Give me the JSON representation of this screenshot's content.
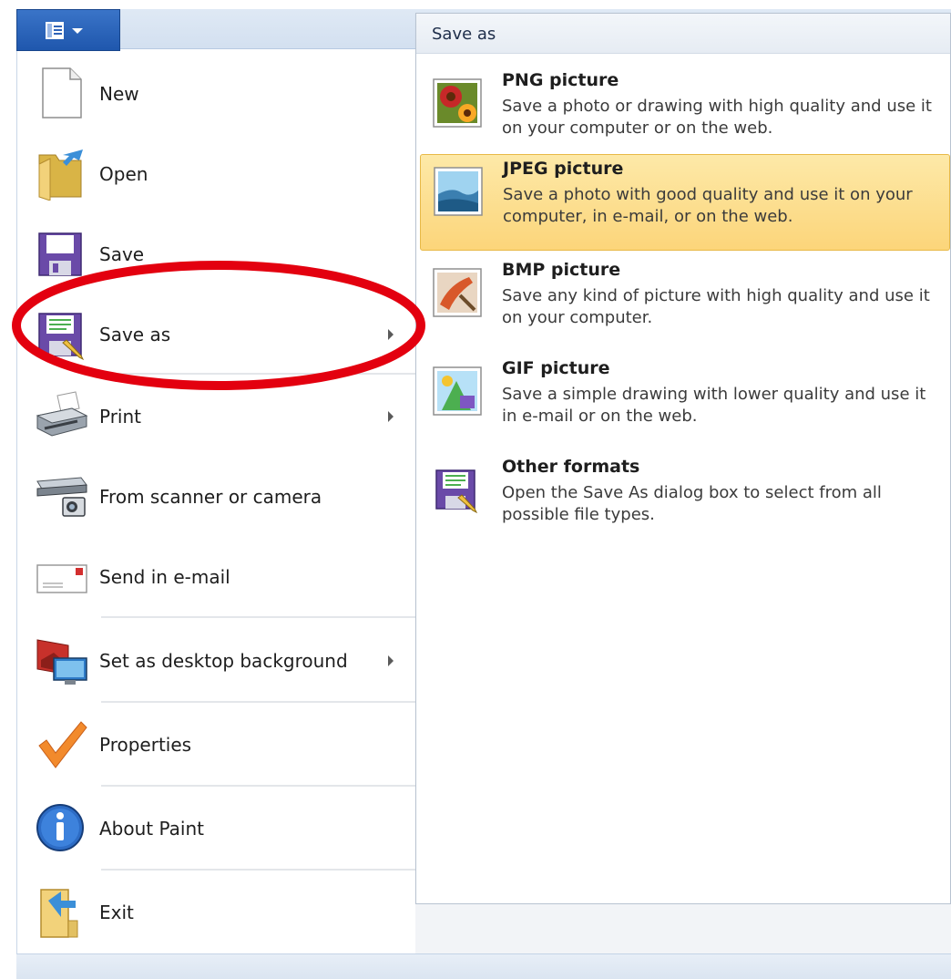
{
  "file_tab": {
    "icon": "file-menu-icon"
  },
  "menu": {
    "items": [
      {
        "name": "new",
        "label": "New",
        "icon": "new-document-icon",
        "submenu": false
      },
      {
        "name": "open",
        "label": "Open",
        "icon": "open-folder-icon",
        "submenu": false
      },
      {
        "name": "save",
        "label": "Save",
        "icon": "floppy-disk-icon",
        "submenu": false
      },
      {
        "name": "save-as",
        "label": "Save as",
        "icon": "save-as-icon",
        "submenu": true
      },
      {
        "name": "print",
        "label": "Print",
        "icon": "printer-icon",
        "submenu": true
      },
      {
        "name": "from-scanner",
        "label": "From scanner or camera",
        "icon": "scanner-icon",
        "submenu": false
      },
      {
        "name": "send-email",
        "label": "Send in e-mail",
        "icon": "envelope-icon",
        "submenu": false
      },
      {
        "name": "desktop-bg",
        "label": "Set as desktop background",
        "icon": "desktop-monitor-icon",
        "submenu": true
      },
      {
        "name": "properties",
        "label": "Properties",
        "icon": "checkmark-icon",
        "submenu": false
      },
      {
        "name": "about",
        "label": "About Paint",
        "icon": "info-icon",
        "submenu": false
      },
      {
        "name": "exit",
        "label": "Exit",
        "icon": "exit-door-icon",
        "submenu": false
      }
    ]
  },
  "submenu": {
    "title": "Save as",
    "formats": [
      {
        "title": "PNG picture",
        "description": "Save a photo or drawing with high quality and use it on your computer or on the web.",
        "icon": "png-flowers-icon",
        "highlighted": false
      },
      {
        "title": "JPEG picture",
        "description": "Save a photo with good quality and use it on your computer, in e-mail, or on the web.",
        "icon": "jpeg-landscape-icon",
        "highlighted": true
      },
      {
        "title": "BMP picture",
        "description": "Save any kind of picture with high quality and use it on your computer.",
        "icon": "bmp-paint-icon",
        "highlighted": false
      },
      {
        "title": "GIF picture",
        "description": "Save a simple drawing with lower quality and use it in e-mail or on the web.",
        "icon": "gif-shapes-icon",
        "highlighted": false
      },
      {
        "title": "Other formats",
        "description": "Open the Save As dialog box to select from all possible file types.",
        "icon": "other-formats-icon",
        "highlighted": false
      }
    ]
  },
  "colors": {
    "accent": "#2a62b8",
    "highlight": "#fcd57a",
    "callout": "#e3000f"
  }
}
